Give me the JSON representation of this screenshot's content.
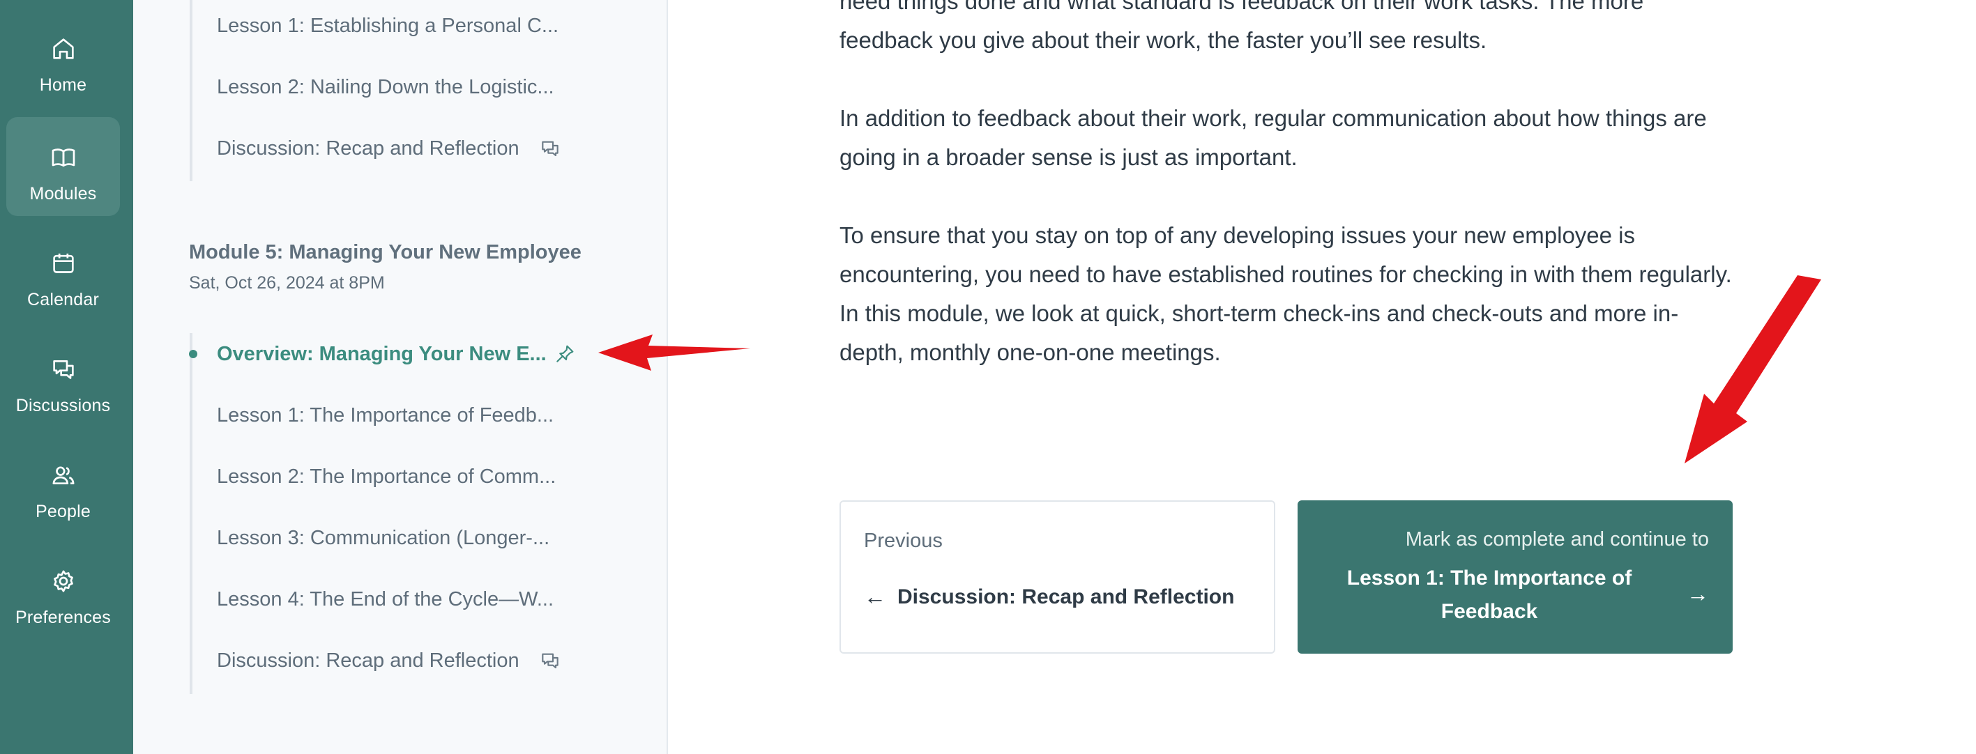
{
  "rail": {
    "items": [
      {
        "label": "Home",
        "icon": "home-icon"
      },
      {
        "label": "Modules",
        "icon": "book-icon",
        "active": true
      },
      {
        "label": "Calendar",
        "icon": "calendar-icon"
      },
      {
        "label": "Discussions",
        "icon": "chat-icon"
      },
      {
        "label": "People",
        "icon": "people-icon"
      },
      {
        "label": "Preferences",
        "icon": "gear-icon"
      }
    ],
    "color": "#3b7670"
  },
  "outline": {
    "previous_group": [
      {
        "label": "Lesson 1: Establishing a Personal C..."
      },
      {
        "label": "Lesson 2: Nailing Down the Logistic..."
      },
      {
        "label": "Discussion: Recap and Reflection",
        "icon": "chat-icon"
      }
    ],
    "module": {
      "title": "Module 5: Managing Your New Employee",
      "date": "Sat, Oct 26, 2024 at 8PM",
      "items": [
        {
          "label": "Overview: Managing Your New E...",
          "icon": "pin-icon",
          "active": true
        },
        {
          "label": "Lesson 1: The Importance of Feedb..."
        },
        {
          "label": "Lesson 2: The Importance of Comm..."
        },
        {
          "label": "Lesson 3: Communication (Longer-..."
        },
        {
          "label": "Lesson 4: The End of the Cycle—W..."
        },
        {
          "label": "Discussion: Recap and Reflection",
          "icon": "chat-icon"
        }
      ]
    },
    "accent": "#3b8c7f"
  },
  "content": {
    "paragraphs": [
      "need things done and what standard is feedback on their work tasks. The more feedback you give about their work, the faster you’ll see results.",
      "In addition to feedback about their work, regular communication about how things are going in a broader sense is just as important.",
      "To ensure that you stay on top of any developing issues your new employee is encountering, you need to have established routines for checking in with them regularly. In this module, we look at quick, short-term check-ins and check-outs and more in-depth, monthly one-on-one meetings."
    ]
  },
  "navigation": {
    "previous": {
      "label": "Previous",
      "arrow": "←",
      "title": "Discussion: Recap and Reflection"
    },
    "next": {
      "label": "Mark as complete and continue to",
      "title": "Lesson 1: The Importance of Feedback",
      "arrow": "→"
    }
  },
  "annotation_color": "#e3151b"
}
